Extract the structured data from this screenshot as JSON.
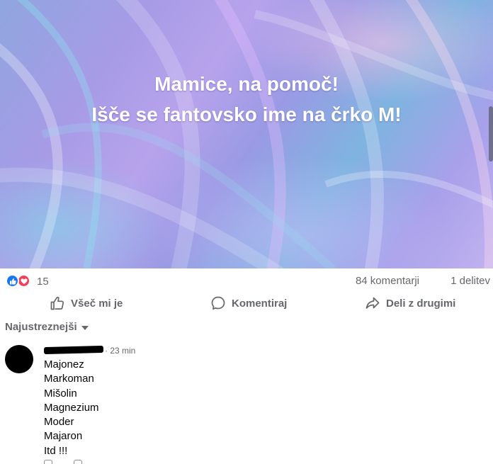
{
  "post": {
    "text_line1": "Mamice, na pomoč!",
    "text_line2": "Išče se fantovsko ime na črko M!"
  },
  "summary": {
    "reaction_count": "15",
    "reactions": [
      "like-icon",
      "love-icon"
    ],
    "comments": "84 komentarji",
    "shares": "1 delitev"
  },
  "actions": {
    "like": "Všeč mi je",
    "comment": "Komentiraj",
    "share": "Deli z drugimi"
  },
  "sort": {
    "label": "Najustreznejši"
  },
  "comment": {
    "time": "· 23 min",
    "lines": [
      "Majonez",
      "Markoman",
      "Mišolin",
      "Magnezium",
      "Moder",
      "Majaron",
      "Itd !!!"
    ]
  },
  "colors": {
    "accent": "#1877f2",
    "love": "#f33e58",
    "muted_text": "#65676b"
  }
}
